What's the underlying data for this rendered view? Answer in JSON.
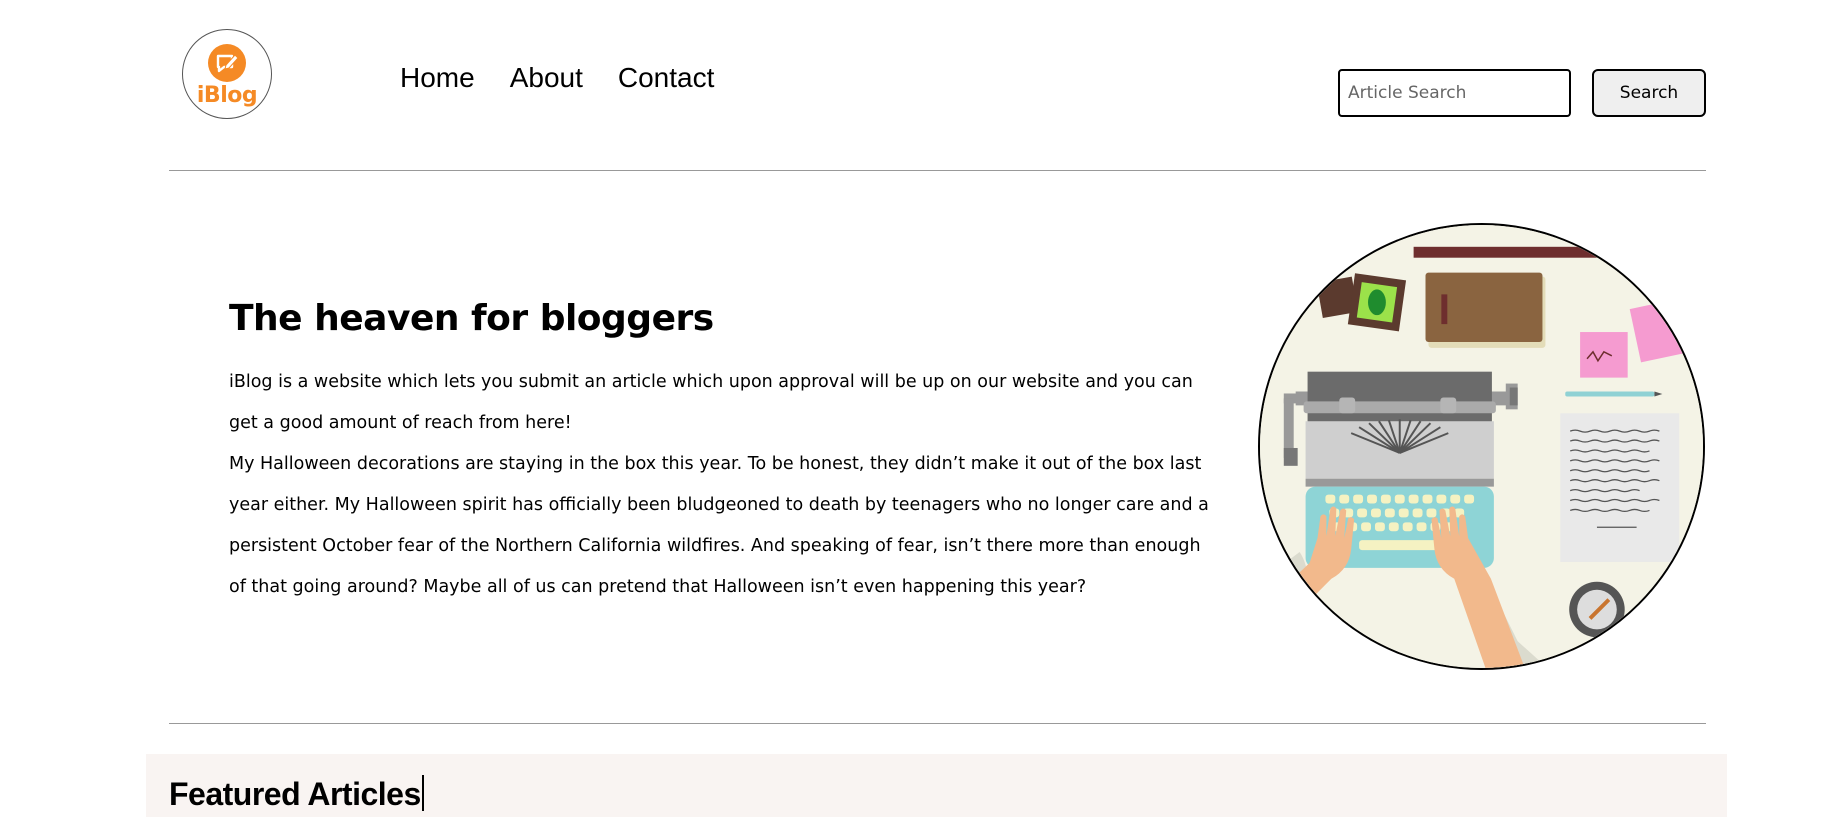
{
  "brand": {
    "name": "iBlog",
    "accent": "#f58a25"
  },
  "nav": {
    "items": [
      {
        "label": "Home"
      },
      {
        "label": "About"
      },
      {
        "label": "Contact"
      }
    ]
  },
  "search": {
    "placeholder": "Article Search",
    "button_label": "Search"
  },
  "hero": {
    "title": "The heaven for bloggers",
    "paragraph_1": "iBlog is a website which lets you submit an article which upon approval will be up on our website and you can get a good amount of reach from here!",
    "paragraph_2": "My Halloween decorations are staying in the box this year. To be honest, they didn’t make it out of the box last year either. My Halloween spirit has officially been bludgeoned to death by teenagers who no longer care and a persistent October fear of the Northern California wildfires. And speaking of fear, isn’t there more than enough of that going around? Maybe all of us can pretend that Halloween isn’t even happening this year?",
    "image_icon": "typewriter-illustration"
  },
  "featured": {
    "title": "Featured Articles"
  }
}
